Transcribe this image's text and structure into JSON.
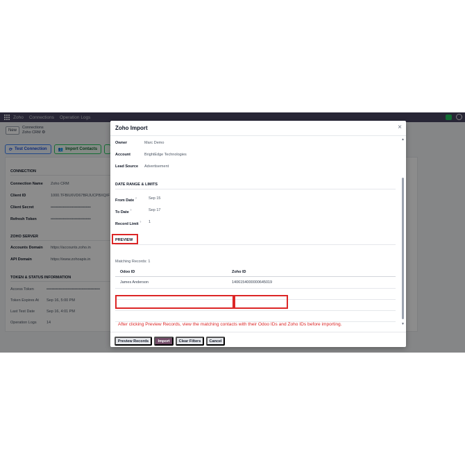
{
  "navbar": {
    "app_name": "Zoho",
    "menu": [
      "Connections",
      "Operation Logs"
    ]
  },
  "breadcrumb": {
    "new_label": "New",
    "parent": "Connections",
    "current": "Zoho CRM"
  },
  "actions": {
    "test_connection": "Test Connection",
    "import_contacts": "Import Contacts"
  },
  "connection": {
    "title": "CONNECTION",
    "fields": [
      {
        "label": "Connection Name",
        "value": "Zoho CRM"
      },
      {
        "label": "Client ID",
        "value": "1000.TFBIU6VD67BRJUCPBXQIF"
      },
      {
        "label": "Client Secret",
        "value": "••••••••••••••••••••••••••••••"
      },
      {
        "label": "Refresh Token",
        "value": "••••••••••••••••••••••••••••••"
      }
    ]
  },
  "zoho_server": {
    "title": "ZOHO SERVER",
    "fields": [
      {
        "label": "Accounts Domain",
        "value": "https://accounts.zoho.in"
      },
      {
        "label": "API Domain",
        "value": "https://www.zohoapis.in"
      }
    ]
  },
  "token_status": {
    "title": "TOKEN & STATUS INFORMATION",
    "fields": [
      {
        "label": "Access Token",
        "value": "••••••••••••••••••••••••••••••••••••••••"
      },
      {
        "label": "Token Expires At",
        "value": "Sep 16, 5:00 PM"
      },
      {
        "label": "Last Test Date",
        "value": "Sep 16, 4:01 PM"
      },
      {
        "label": "Operation Logs",
        "value": "14"
      }
    ]
  },
  "modal": {
    "title": "Zoho Import",
    "close_icon": "×",
    "owner": {
      "label": "Owner",
      "value": "Marc Demo"
    },
    "account": {
      "label": "Account",
      "value": "BrightEdge Technologies"
    },
    "lead_source": {
      "label": "Lead Source",
      "value": "Advertisement"
    },
    "date_section": "DATE RANGE & LIMITS",
    "from_date": {
      "label": "From Date",
      "value": "Sep 15"
    },
    "to_date": {
      "label": "To Date",
      "value": "Sep 17"
    },
    "record_limit": {
      "label": "Record Limit",
      "value": "1"
    },
    "preview_section": "PREVIEW",
    "matching": "Matching Records: 1",
    "table": {
      "headers": [
        "Odoo ID",
        "Zoho ID"
      ],
      "rows": [
        [
          "James Anderson",
          "1406154000000645019"
        ]
      ]
    },
    "annotation": "After clicking Preview Records, view the matching contacts with their Odoo IDs and Zoho IDs before importing.",
    "buttons": {
      "preview": "Preview Records",
      "import": "Import",
      "clear": "Clear Filters",
      "cancel": "Cancel"
    }
  },
  "colors": {
    "navbar": "#4a4563",
    "primary": "#714b67",
    "highlight": "#dc2626"
  }
}
